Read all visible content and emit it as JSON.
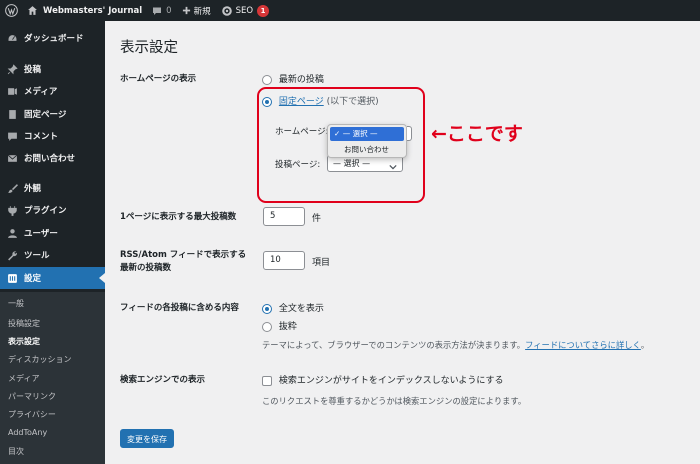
{
  "adminbar": {
    "site_name": "Webmasters' Journal",
    "comments_count": "0",
    "new_label": "新規",
    "seo_label": "SEO",
    "seo_badge": "1"
  },
  "sidebar": {
    "items": [
      {
        "label": "ダッシュボード",
        "icon": "dashboard-icon"
      },
      {
        "label": "投稿",
        "icon": "pin-icon"
      },
      {
        "label": "メディア",
        "icon": "media-icon"
      },
      {
        "label": "固定ページ",
        "icon": "page-icon"
      },
      {
        "label": "コメント",
        "icon": "comment-icon"
      },
      {
        "label": "お問い合わせ",
        "icon": "mail-icon"
      },
      {
        "label": "外観",
        "icon": "brush-icon"
      },
      {
        "label": "プラグイン",
        "icon": "plugin-icon"
      },
      {
        "label": "ユーザー",
        "icon": "user-icon"
      },
      {
        "label": "ツール",
        "icon": "wrench-icon"
      },
      {
        "label": "設定",
        "icon": "settings-icon"
      }
    ],
    "submenu": [
      "一般",
      "投稿設定",
      "表示設定",
      "ディスカッション",
      "メディア",
      "パーマリンク",
      "プライバシー",
      "AddToAny",
      "目次"
    ]
  },
  "page": {
    "title": "表示設定",
    "homepage": {
      "label": "ホームページの表示",
      "option_latest": "最新の投稿",
      "option_static_link": "固定ページ",
      "option_static_suffix": "(以下で選択)",
      "homepage_select_label": "ホームページ:",
      "posts_page_label": "投稿ページ:",
      "posts_page_value": "— 選択 —",
      "dropdown_options": [
        "— 選択 —",
        "お問い合わせ"
      ],
      "dropdown_selected": "— 選択 —"
    },
    "annotation": "←ここです",
    "posts_per_page": {
      "label": "1ページに表示する最大投稿数",
      "value": "5",
      "unit": "件"
    },
    "feed_count": {
      "label_line1": "RSS/Atom フィードで表示する",
      "label_line2": "最新の投稿数",
      "value": "10",
      "unit": "項目"
    },
    "feed_content": {
      "label": "フィードの各投稿に含める内容",
      "option_full": "全文を表示",
      "option_excerpt": "抜粋",
      "description": "テーマによって、ブラウザーでのコンテンツの表示方法が決まります。",
      "description_link": "フィードについてさらに詳しく",
      "description_end": "。"
    },
    "search_engine": {
      "label": "検索エンジンでの表示",
      "checkbox_label": "検索エンジンがサイトをインデックスしないようにする",
      "note": "このリクエストを尊重するかどうかは検索エンジンの設定によります。"
    },
    "save_button": "変更を保存"
  }
}
